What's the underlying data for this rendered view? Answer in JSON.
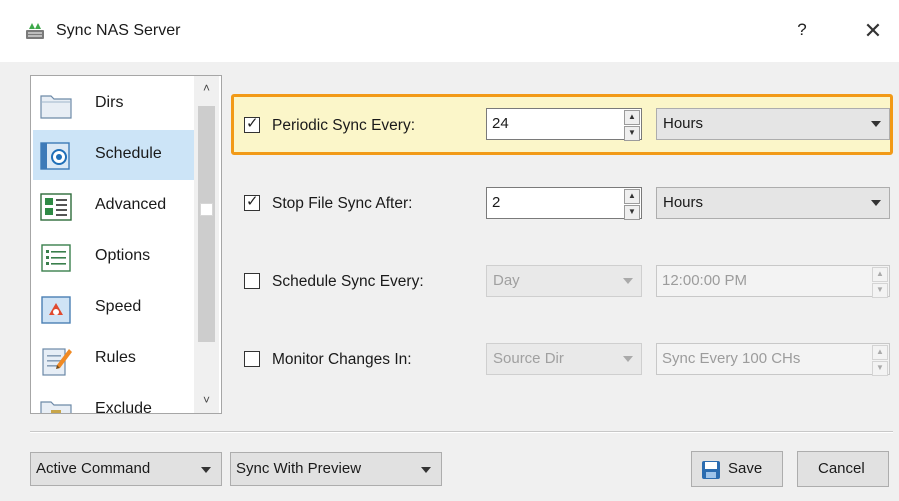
{
  "window": {
    "title": "Sync NAS Server",
    "help_glyph": "?",
    "close_glyph": "✕"
  },
  "nav": {
    "items": [
      {
        "label": "Dirs",
        "icon": "folder-icon"
      },
      {
        "label": "Schedule",
        "icon": "schedule-icon"
      },
      {
        "label": "Advanced",
        "icon": "advanced-icon"
      },
      {
        "label": "Options",
        "icon": "options-icon"
      },
      {
        "label": "Speed",
        "icon": "speed-icon"
      },
      {
        "label": "Rules",
        "icon": "rules-icon"
      },
      {
        "label": "Exclude",
        "icon": "exclude-icon"
      }
    ],
    "selected": "Schedule"
  },
  "schedule": {
    "periodic": {
      "label": "Periodic Sync Every:",
      "checked": true,
      "value": "24",
      "unit": "Hours"
    },
    "stop": {
      "label": "Stop File Sync After:",
      "checked": true,
      "value": "2",
      "unit": "Hours"
    },
    "schedule_sync": {
      "label": "Schedule Sync Every:",
      "checked": false,
      "period": "Day",
      "time": "12:00:00 PM"
    },
    "monitor": {
      "label": "Monitor Changes In:",
      "checked": false,
      "source": "Source Dir",
      "sync_every": "Sync Every 100 CHs"
    }
  },
  "bottom": {
    "active_command": "Active Command",
    "sync_mode": "Sync With Preview",
    "save_label": "Save",
    "cancel_label": "Cancel"
  },
  "colors": {
    "highlight_border": "#f29a17",
    "highlight_fill": "#fbf6c9",
    "selected_nav": "#cce4f7"
  }
}
